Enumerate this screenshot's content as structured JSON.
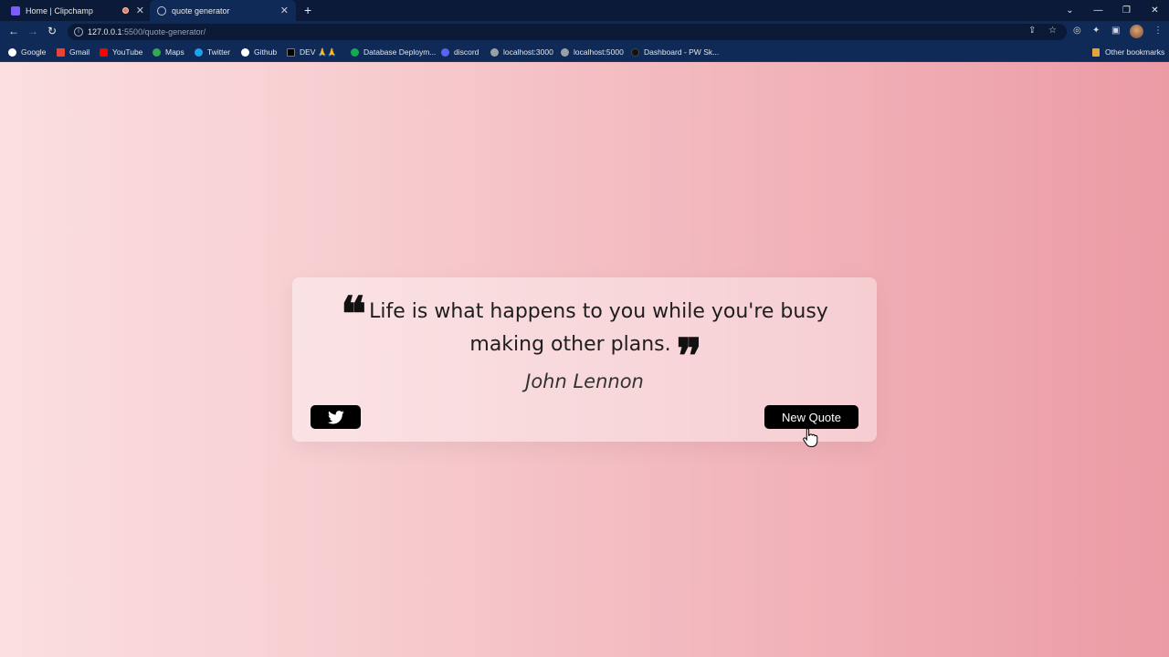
{
  "browser": {
    "tabs": [
      {
        "title": "Home | Clipchamp",
        "active": false
      },
      {
        "title": "quote generator",
        "active": true
      }
    ],
    "new_tab_icon": "plus-icon",
    "window_controls": [
      "minimize-icon",
      "restore-icon",
      "close-icon"
    ],
    "url_host": "127.0.0.1",
    "url_path": ":5500/quote-generator/",
    "bookmarks": [
      {
        "label": "Google",
        "icon": "google-icon",
        "color": "#ffffff"
      },
      {
        "label": "Gmail",
        "icon": "gmail-icon",
        "color": "#ea4335"
      },
      {
        "label": "YouTube",
        "icon": "youtube-icon",
        "color": "#ff0000"
      },
      {
        "label": "Maps",
        "icon": "maps-icon",
        "color": "#34a853"
      },
      {
        "label": "Twitter",
        "icon": "twitter-icon",
        "color": "#1da1f2"
      },
      {
        "label": "Github",
        "icon": "github-icon",
        "color": "#ffffff"
      },
      {
        "label": "DEV 🙏🙏",
        "icon": "dev-icon",
        "color": "#000000"
      },
      {
        "label": "Database Deploym...",
        "icon": "database-icon",
        "color": "#13aa52"
      },
      {
        "label": "discord",
        "icon": "discord-icon",
        "color": "#5865f2"
      },
      {
        "label": "localhost:3000",
        "icon": "globe-icon",
        "color": "#9aa0a6"
      },
      {
        "label": "localhost:5000",
        "icon": "globe-icon",
        "color": "#9aa0a6"
      },
      {
        "label": "Dashboard - PW Sk...",
        "icon": "pw-icon",
        "color": "#111111"
      }
    ],
    "other_bookmarks": "Other bookmarks"
  },
  "quote": {
    "text": "Life is what happens to you while you're busy making other plans.",
    "author": "John Lennon",
    "twitter_button_icon": "twitter-icon",
    "new_quote_label": "New Quote"
  },
  "colors": {
    "gradient_start": "#fbdfe0",
    "gradient_end": "#ec9ba5",
    "button_bg": "#000000"
  }
}
